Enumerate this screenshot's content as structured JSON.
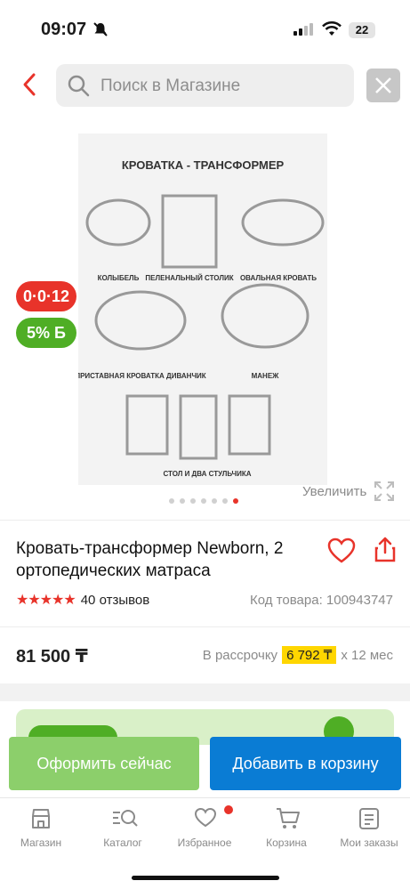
{
  "status_bar": {
    "time": "09:07",
    "battery": "22"
  },
  "search": {
    "placeholder": "Поиск в Магазине"
  },
  "gallery": {
    "badge_installment": "0·0·12",
    "badge_bonus": "5% Б",
    "zoom_label": "Увеличить",
    "dots_total": 7,
    "active_dot": 7,
    "image_text": {
      "heading": "КРОВАТКА - ТРАНСФОРМЕР",
      "labels": [
        "КОЛЫБЕЛЬ",
        "ПЕЛЕНАЛЬНЫЙ СТОЛИК",
        "ОВАЛЬНАЯ КРОВАТЬ",
        "ПРИСТАВНАЯ КРОВАТКА ДИВАНЧИК",
        "МАНЕЖ",
        "СТОЛ И ДВА СТУЛЬЧИКА"
      ]
    }
  },
  "product": {
    "title": "Кровать-трансформер Newborn, 2 ортопедических матраса",
    "rating_stars": 5,
    "reviews": "40 отзывов",
    "code": "Код товара: 100943747",
    "price": "81 500 ₸",
    "installment_label": "В рассрочку",
    "installment_amount": "6 792 ₸",
    "installment_months": "х 12 мес"
  },
  "actions": {
    "order_now": "Оформить сейчас",
    "add_to_cart": "Добавить в корзину"
  },
  "bottom_nav": {
    "items": [
      {
        "label": "Магазин",
        "icon": "store-icon"
      },
      {
        "label": "Каталог",
        "icon": "catalog-search-icon"
      },
      {
        "label": "Избранное",
        "icon": "heart-icon"
      },
      {
        "label": "Корзина",
        "icon": "cart-icon"
      },
      {
        "label": "Мои заказы",
        "icon": "orders-icon"
      }
    ]
  },
  "colors": {
    "accent_red": "#e8332a",
    "green": "#4fae25",
    "blue": "#0a7cd4",
    "yellow": "#ffd600"
  }
}
